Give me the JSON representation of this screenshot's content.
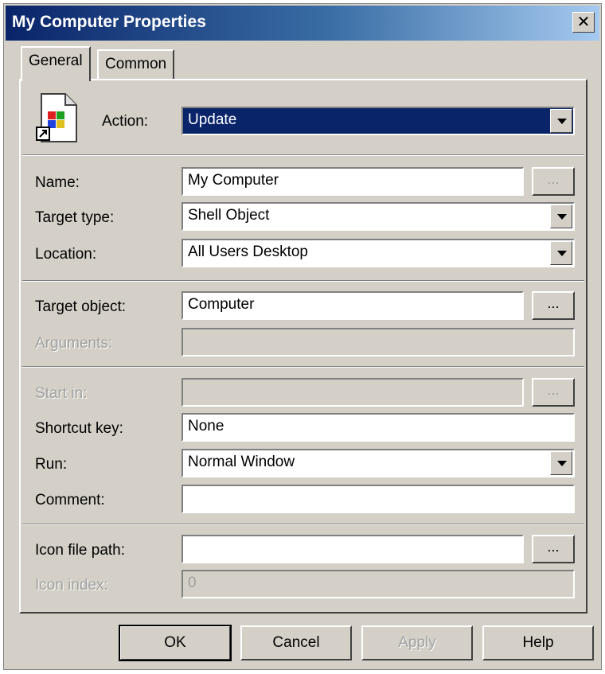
{
  "window": {
    "title": "My Computer Properties",
    "close_glyph": "✕"
  },
  "tabs": [
    {
      "label": "General",
      "active": true
    },
    {
      "label": "Common",
      "active": false
    }
  ],
  "action": {
    "label": "Action:",
    "value": "Update",
    "icon": "shortcut-file-icon"
  },
  "name": {
    "label": "Name:",
    "value": "My Computer",
    "browse": "..."
  },
  "target_type": {
    "label": "Target type:",
    "value": "Shell Object"
  },
  "location": {
    "label": "Location:",
    "value": "All Users Desktop"
  },
  "target_object": {
    "label": "Target object:",
    "value": "Computer",
    "browse": "..."
  },
  "arguments": {
    "label": "Arguments:",
    "value": ""
  },
  "start_in": {
    "label": "Start in:",
    "value": "",
    "browse": "..."
  },
  "shortcut_key": {
    "label": "Shortcut key:",
    "value": "None"
  },
  "run": {
    "label": "Run:",
    "value": "Normal Window"
  },
  "comment": {
    "label": "Comment:",
    "value": ""
  },
  "icon_file_path": {
    "label": "Icon file path:",
    "value": "",
    "browse": "..."
  },
  "icon_index": {
    "label": "Icon index:",
    "value": "0"
  },
  "buttons": {
    "ok": "OK",
    "cancel": "Cancel",
    "apply": "Apply",
    "help": "Help"
  },
  "colors": {
    "titlebar": "#0a246a",
    "dialog_bg": "#d4d0c8",
    "selection": "#0a246a"
  }
}
